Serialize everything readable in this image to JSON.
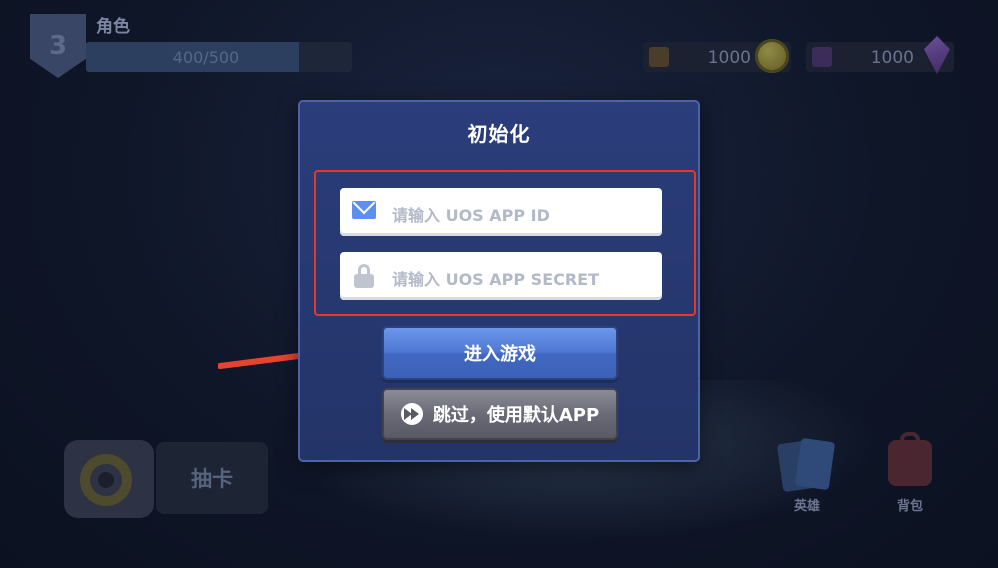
{
  "hud": {
    "level": "3",
    "role_label": "角色",
    "xp_text": "400/500",
    "xp_progress": 0.8,
    "currencies": [
      {
        "icon": "coin-icon",
        "value": "1000"
      },
      {
        "icon": "gem-icon",
        "value": "1000"
      }
    ],
    "gacha_label": "抽卡",
    "nav": {
      "hero_label": "英雄",
      "bag_label": "背包"
    }
  },
  "dialog": {
    "title": "初始化",
    "app_id_placeholder": "请输入 UOS APP ID",
    "app_secret_placeholder": "请输入 UOS APP SECRET",
    "enter_label": "进入游戏",
    "skip_label": "跳过，使用默认APP"
  },
  "colors": {
    "highlight": "#e23a2a",
    "enter_button": "#4f78d3",
    "dialog_bg": "#2b3d7b"
  }
}
